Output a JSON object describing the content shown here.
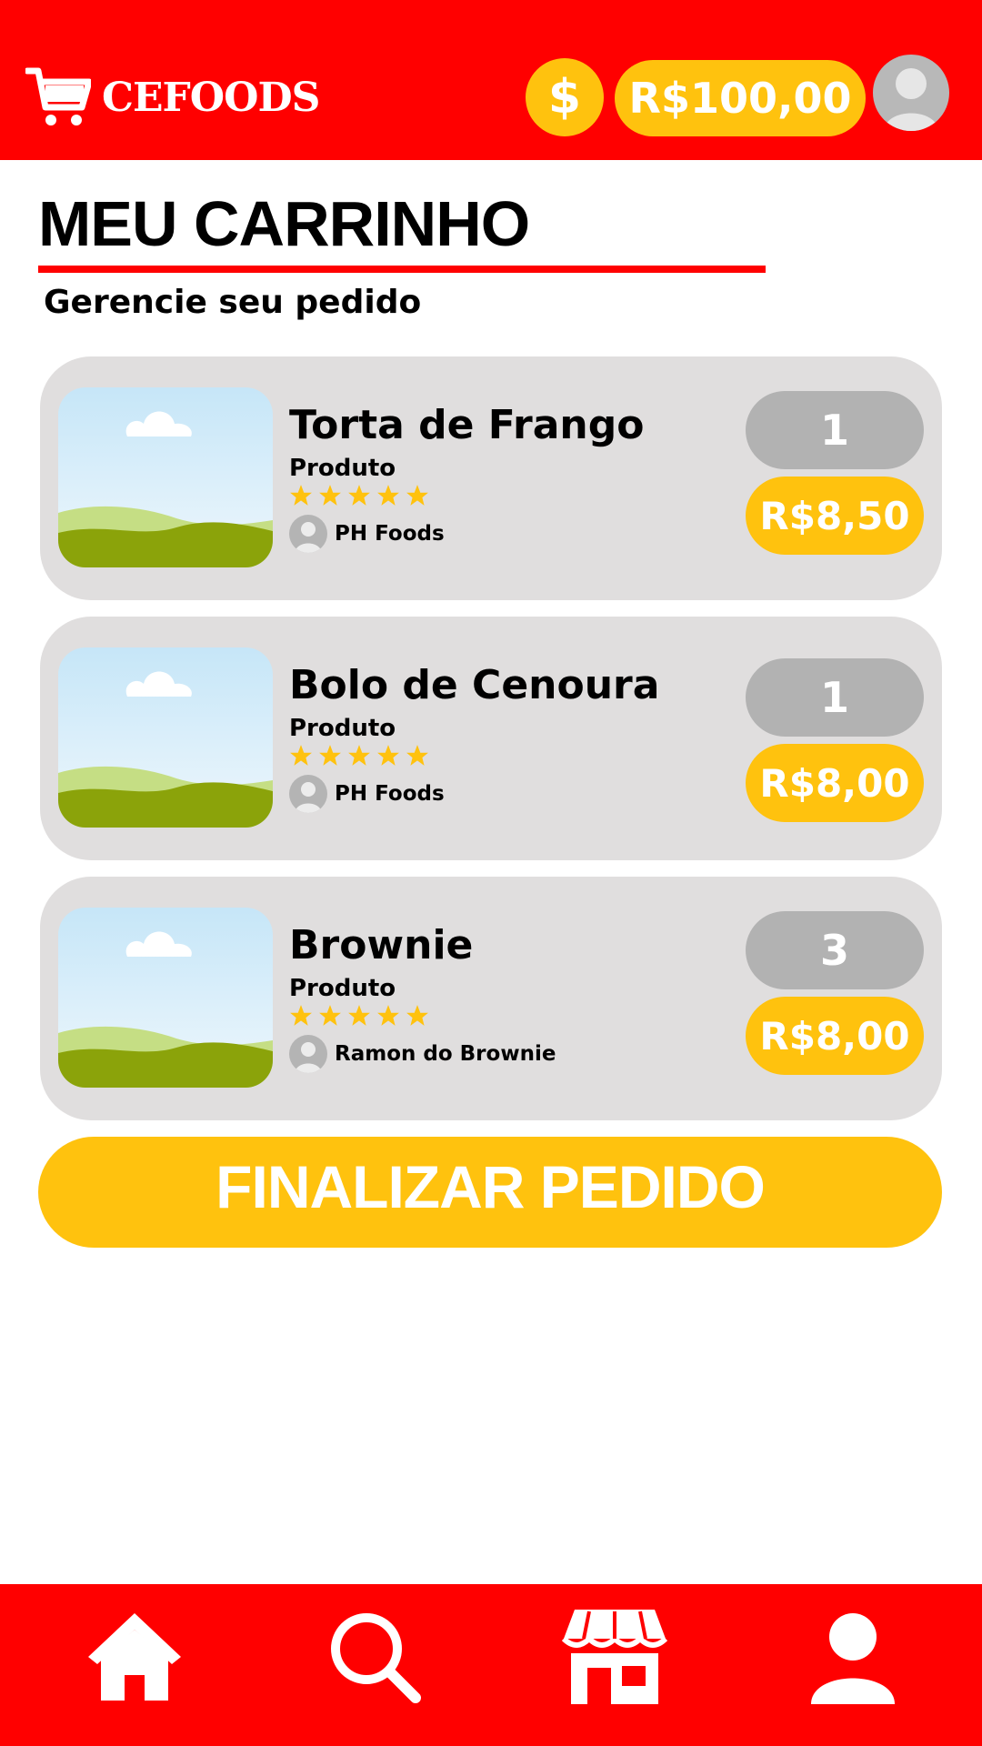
{
  "header": {
    "app_name": "CEFOODS",
    "coin_symbol": "$",
    "balance": "R$100,00"
  },
  "page": {
    "title": "MEU CARRINHO",
    "subtitle": "Gerencie seu pedido"
  },
  "cart": {
    "items": [
      {
        "name": "Torta de Frango",
        "type": "Produto",
        "rating": 5,
        "seller": "PH Foods",
        "quantity": "1",
        "price": "R$8,50"
      },
      {
        "name": "Bolo de Cenoura",
        "type": "Produto",
        "rating": 5,
        "seller": "PH Foods",
        "quantity": "1",
        "price": "R$8,00"
      },
      {
        "name": "Brownie",
        "type": "Produto",
        "rating": 5,
        "seller": "Ramon do Brownie",
        "quantity": "3",
        "price": "R$8,00"
      }
    ]
  },
  "actions": {
    "finalize_label": "FINALIZAR PEDIDO"
  },
  "nav": {
    "icons": [
      "home-icon",
      "search-icon",
      "store-icon",
      "profile-icon"
    ]
  },
  "colors": {
    "primary_red": "#ff0000",
    "accent_yellow": "#ffc20e",
    "card_bg": "#e0dede",
    "qty_gray": "#b2b2b2"
  }
}
